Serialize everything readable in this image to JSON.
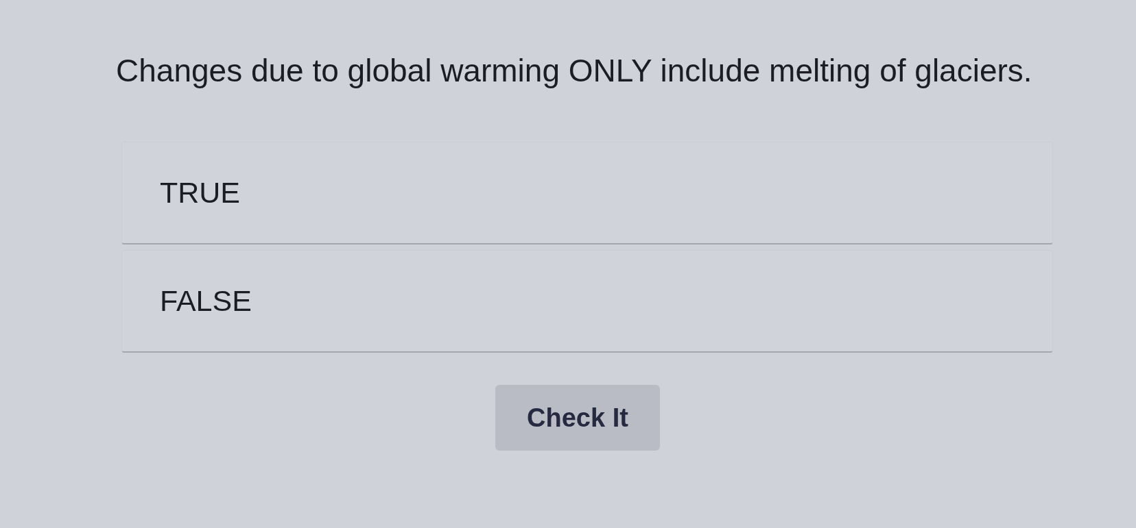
{
  "question": {
    "text": "Changes due to global warming ONLY include melting of glaciers."
  },
  "options": [
    {
      "label": "TRUE",
      "selected": false
    },
    {
      "label": "FALSE",
      "selected": false
    }
  ],
  "check_button": {
    "label": "Check It"
  }
}
